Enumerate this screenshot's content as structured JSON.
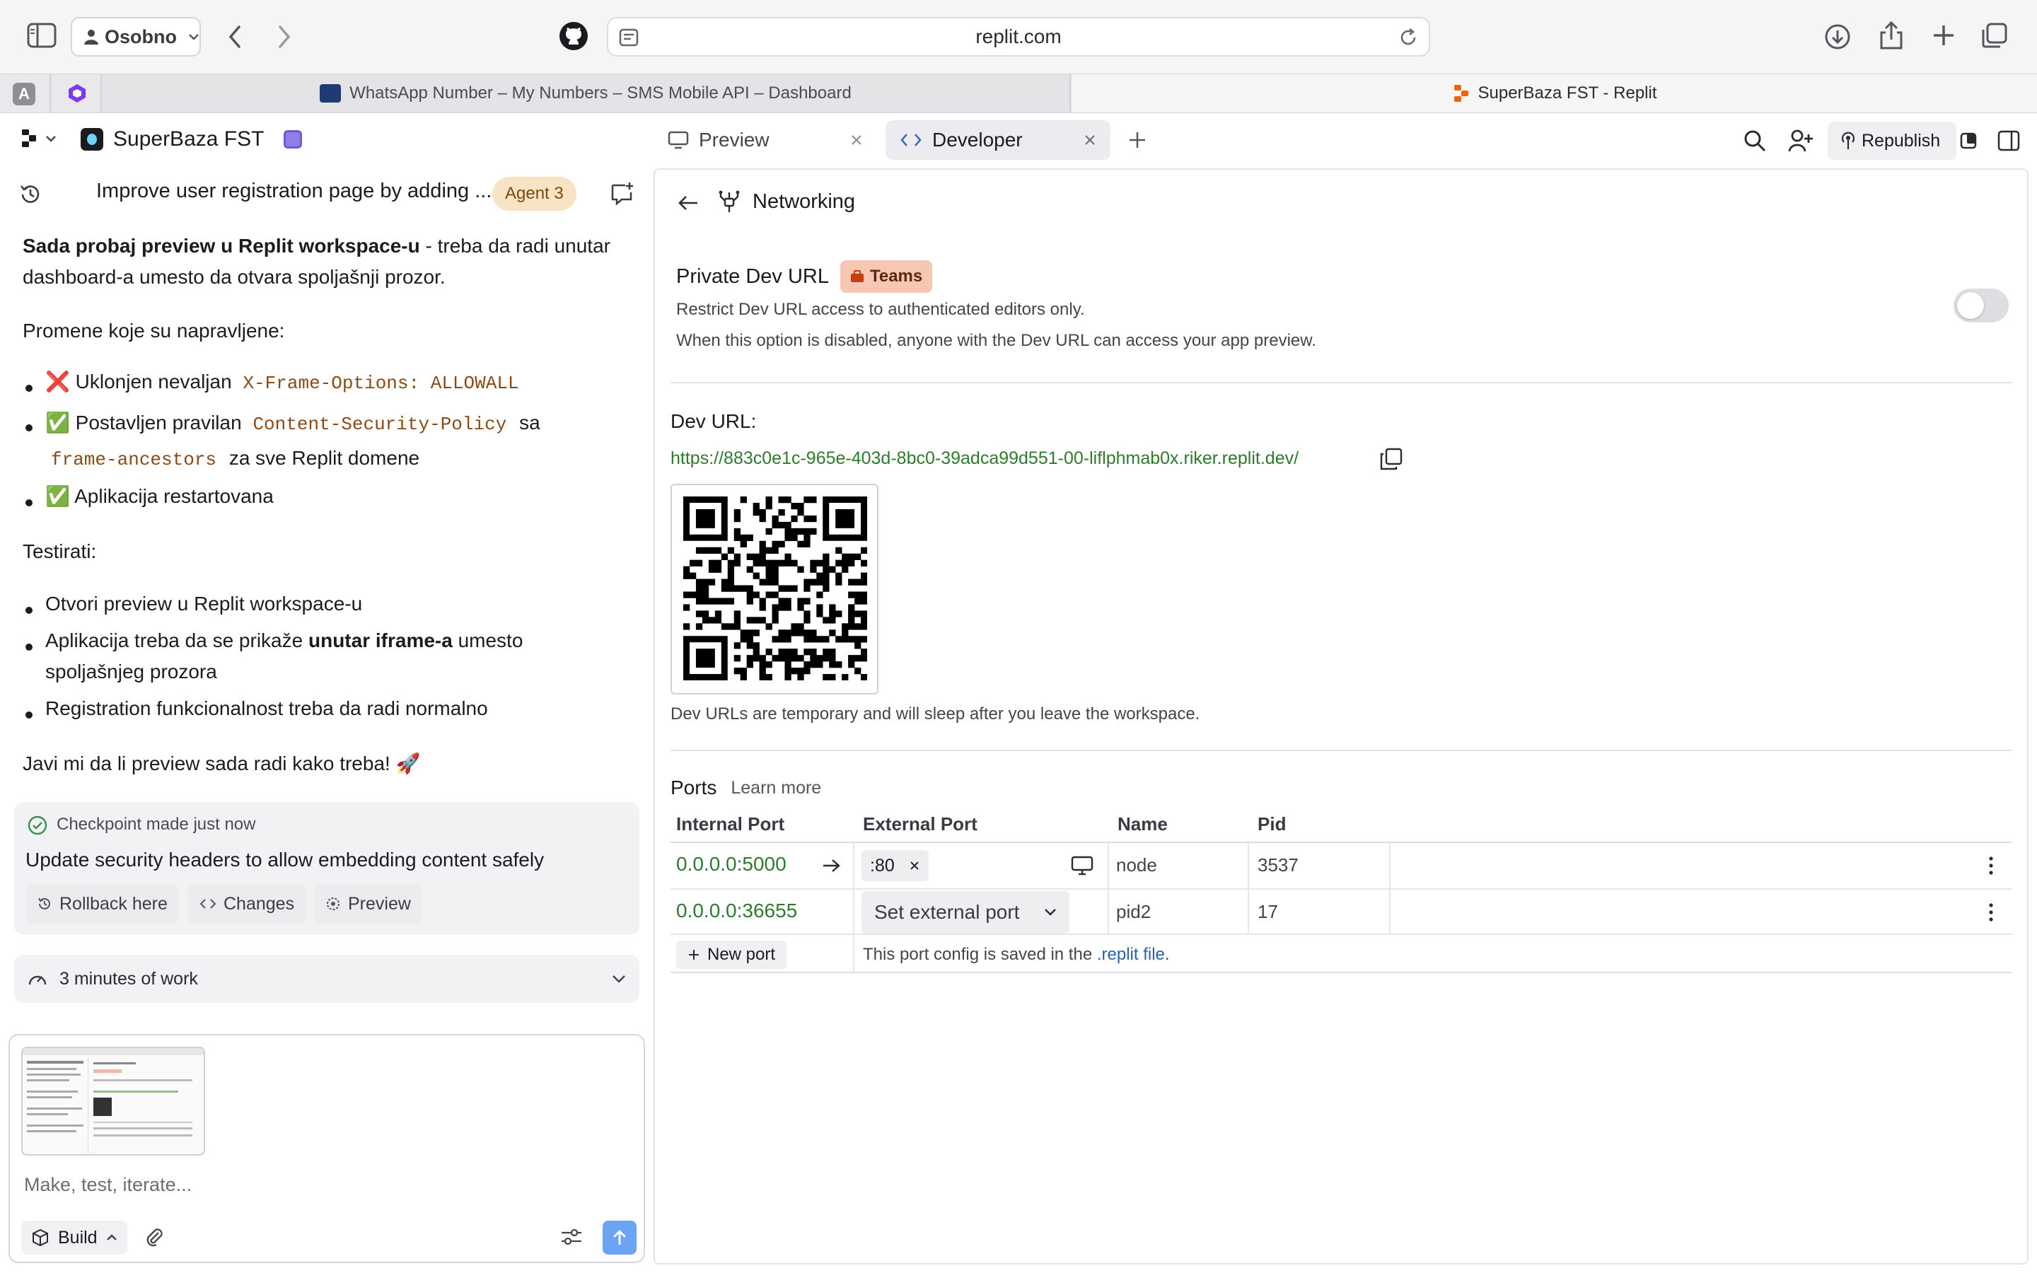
{
  "browser": {
    "profile_label": "Osobno",
    "url": "replit.com",
    "tabs": [
      {
        "title": "WhatsApp Number – My Numbers – SMS Mobile API – Dashboard"
      },
      {
        "title": "SuperBaza FST - Replit"
      }
    ],
    "pinned_a": "A"
  },
  "app": {
    "project_name": "SuperBaza FST",
    "tabs": [
      {
        "label": "Preview"
      },
      {
        "label": "Developer"
      }
    ],
    "republish_label": "Republish"
  },
  "chat": {
    "thread_title": "Improve user registration page by adding ...",
    "agent_badge": "Agent 3",
    "intro_bold": "Sada probaj preview u Replit workspace-u",
    "intro_rest_1": " - treba da radi unutar",
    "intro_rest_2": "dashboard-a umesto da otvara spoljašnji prozor.",
    "changes_heading": "Promene koje su napravljene:",
    "change_1_text": "❌ Uklonjen nevaljan",
    "change_1_code": "X-Frame-Options: ALLOWALL",
    "change_2_text": "✅ Postavljen pravilan",
    "change_2_code": "Content-Security-Policy",
    "change_2_after": "sa",
    "change_2_code2": "frame-ancestors",
    "change_2_tail": "za sve Replit domene",
    "change_3_text": "✅ Aplikacija restartovana",
    "test_heading": "Testirati:",
    "test_1": "Otvori preview u Replit workspace-u",
    "test_2_pre": "Aplikacija treba da se prikaže ",
    "test_2_bold": "unutar iframe-a",
    "test_2_post": " umesto",
    "test_2_line2": "spoljašnjeg prozora",
    "test_3": "Registration funkcionalnost treba da radi normalno",
    "closing": "Javi mi da li preview sada radi kako treba! 🚀",
    "checkpoint_label": "Checkpoint made just now",
    "checkpoint_title": "Update security headers to allow embedding content safely",
    "rollback_label": "Rollback here",
    "changes_label": "Changes",
    "preview_label": "Preview",
    "work_summary": "3 minutes of work",
    "input_placeholder": "Make, test, iterate...",
    "build_label": "Build"
  },
  "networking": {
    "title": "Networking",
    "private_url_label": "Private Dev URL",
    "teams_badge": "Teams",
    "private_desc_1": "Restrict Dev URL access to authenticated editors only.",
    "private_desc_2": "When this option is disabled, anyone with the Dev URL can access your app preview.",
    "private_toggle_on": false,
    "dev_url_label": "Dev URL:",
    "dev_url": "https://883c0e1c-965e-403d-8bc0-39adca99d551-00-liflphmab0x.riker.replit.dev/",
    "dev_url_note": "Dev URLs are temporary and will sleep after you leave the workspace.",
    "ports_label": "Ports",
    "learn_more": "Learn more",
    "columns": [
      "Internal Port",
      "External Port",
      "Name",
      "Pid"
    ],
    "rows": [
      {
        "internal": "0.0.0.0:5000",
        "external": ":80",
        "name": "node",
        "pid": "3537"
      },
      {
        "internal": "0.0.0.0:36655",
        "external": "Set external port",
        "name": "pid2",
        "pid": "17"
      }
    ],
    "new_port_label": "New port",
    "config_note_pre": "This port config is saved in the ",
    "config_note_link": ".replit file",
    "config_note_post": "."
  }
}
